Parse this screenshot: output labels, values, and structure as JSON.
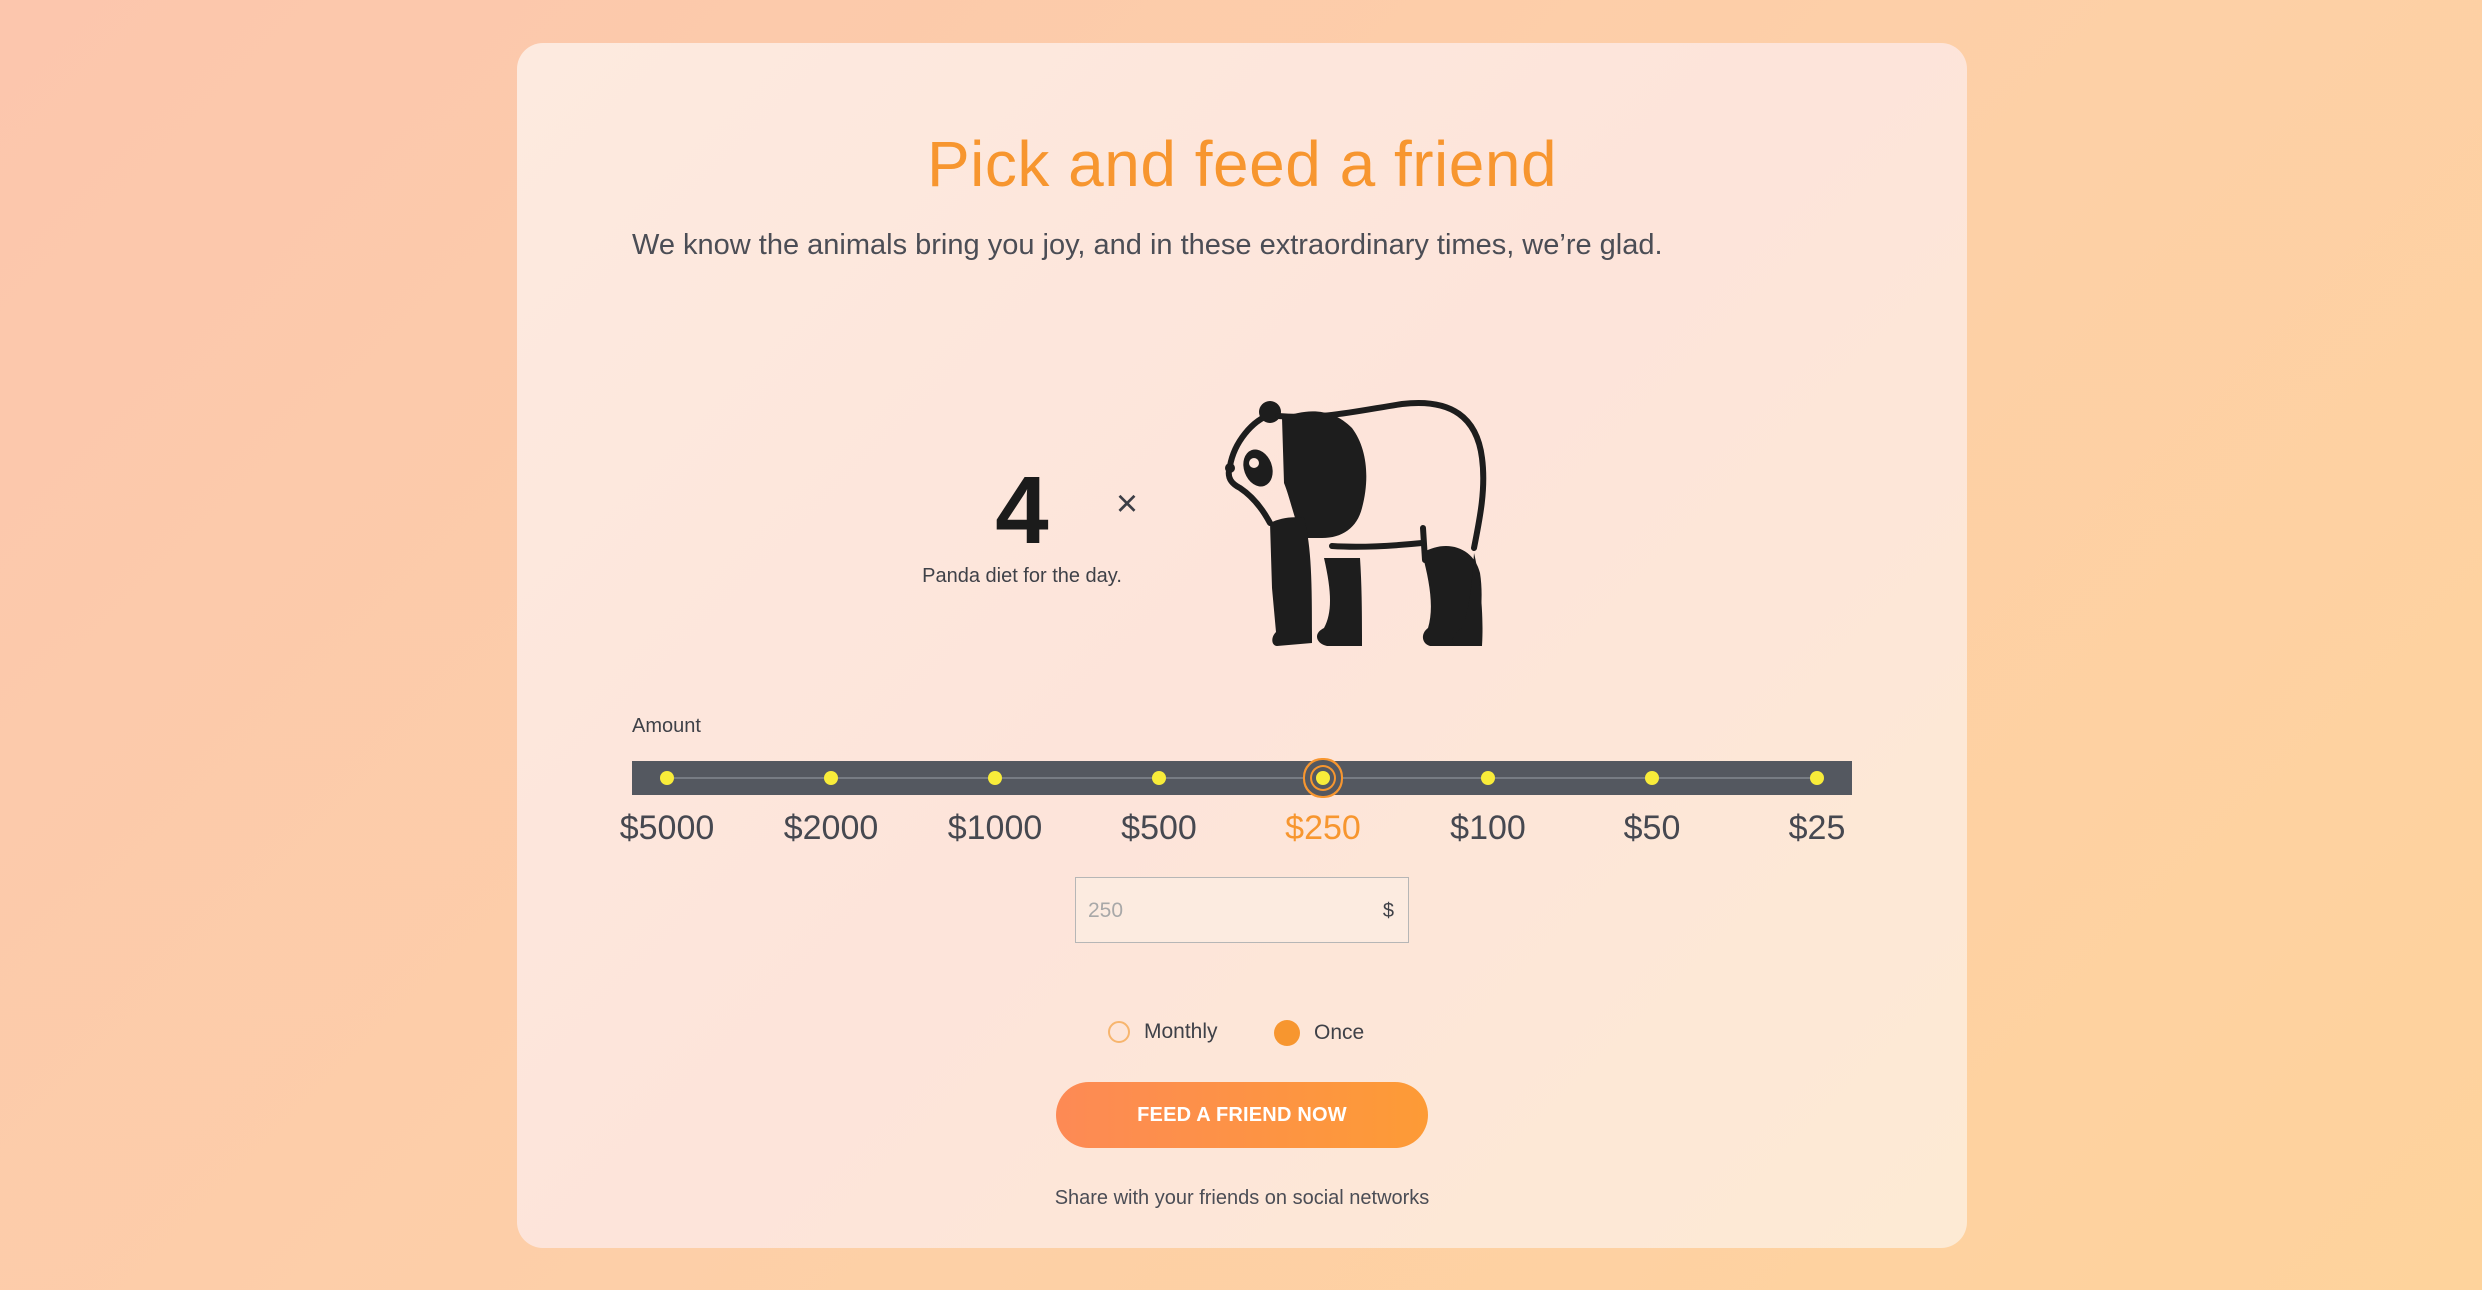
{
  "header": {
    "title": "Pick and feed a friend",
    "subtitle": "We know the animals bring you joy, and in these extraordinary times, we’re glad."
  },
  "meal": {
    "count": "4",
    "label": "Panda diet for the day.",
    "multiplier_symbol": "×",
    "animal_icon": "panda-icon"
  },
  "amount": {
    "label": "Amount",
    "options": [
      "$5000",
      "$2000",
      "$1000",
      "$500",
      "$250",
      "$100",
      "$50",
      "$25"
    ],
    "selected": "$250"
  },
  "custom_amount": {
    "placeholder": "250",
    "currency": "$"
  },
  "frequency": {
    "options": [
      "Monthly",
      "Once"
    ],
    "selected": "Once"
  },
  "cta": {
    "label": "FEED A FRIEND NOW"
  },
  "footer": {
    "share_text": "Share with your friends on social networks"
  },
  "colors": {
    "accent": "#f7962f",
    "slider_track": "#545860",
    "slider_dot": "#f8ec3a",
    "text": "#3f4148"
  }
}
